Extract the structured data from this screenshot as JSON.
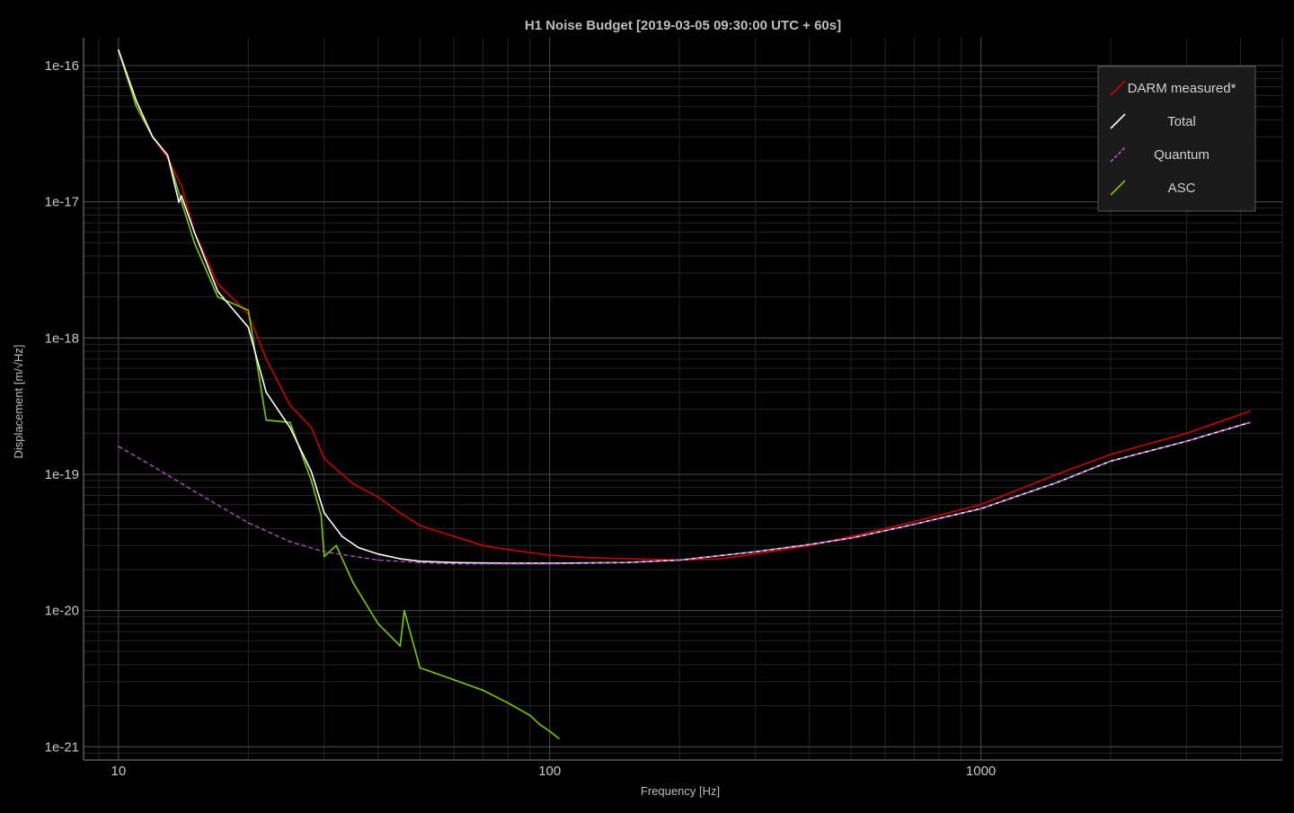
{
  "chart_data": {
    "type": "line",
    "title": "H1 Noise Budget [2019-03-05 09:30:00 UTC + 60s]",
    "xlabel": "Frequency [Hz]",
    "ylabel": "Displacement [m/√Hz]",
    "xscale": "log",
    "yscale": "log",
    "xlim": [
      8.3,
      5000
    ],
    "ylim": [
      8e-22,
      1.6e-16
    ],
    "grid": true,
    "legend_position": "top-right",
    "x_tick_labels": [
      "10",
      "100",
      "1000"
    ],
    "x_tick_values": [
      10,
      100,
      1000
    ],
    "y_tick_labels": [
      "1e-21",
      "1e-20",
      "1e-19",
      "1e-18",
      "1e-17",
      "1e-16"
    ],
    "y_tick_values": [
      1e-21,
      1e-20,
      1e-19,
      1e-18,
      1e-17,
      1e-16
    ],
    "series": [
      {
        "name": "DARM measured*",
        "color": "#cc0000",
        "x": [
          10,
          11,
          12,
          13,
          14,
          15,
          17,
          20,
          22,
          25,
          28,
          30,
          35,
          40,
          45,
          50,
          60,
          70,
          80,
          100,
          120,
          150,
          200,
          250,
          300,
          400,
          500,
          700,
          1000,
          1500,
          2000,
          3000,
          4200
        ],
        "y": [
          1.3e-16,
          5.5e-17,
          3e-17,
          2.1e-17,
          1.3e-17,
          6e-18,
          2.5e-18,
          1.5e-18,
          7e-19,
          3.2e-19,
          2.2e-19,
          1.3e-19,
          8.5e-20,
          6.8e-20,
          5.2e-20,
          4.2e-20,
          3.5e-20,
          3e-20,
          2.8e-20,
          2.55e-20,
          2.45e-20,
          2.4e-20,
          2.35e-20,
          2.4e-20,
          2.6e-20,
          3e-20,
          3.5e-20,
          4.5e-20,
          6e-20,
          1e-19,
          1.4e-19,
          2e-19,
          2.9e-19
        ]
      },
      {
        "name": "Total",
        "color": "#ffffff",
        "x": [
          10,
          11,
          12,
          13,
          13.8,
          14,
          15,
          17,
          20,
          22,
          25,
          28,
          30,
          33,
          36,
          40,
          45,
          50,
          60,
          80,
          100,
          150,
          200,
          300,
          400,
          500,
          700,
          1000,
          1500,
          2000,
          3000,
          4200
        ],
        "y": [
          1.3e-16,
          5.5e-17,
          3e-17,
          2.2e-17,
          1e-17,
          1.1e-17,
          6e-18,
          2.2e-18,
          1.2e-18,
          4e-19,
          2.2e-19,
          1.05e-19,
          5.2e-20,
          3.5e-20,
          2.9e-20,
          2.6e-20,
          2.4e-20,
          2.3e-20,
          2.25e-20,
          2.22e-20,
          2.22e-20,
          2.25e-20,
          2.35e-20,
          2.7e-20,
          3.05e-20,
          3.4e-20,
          4.3e-20,
          5.6e-20,
          8.7e-20,
          1.25e-19,
          1.75e-19,
          2.4e-19
        ]
      },
      {
        "name": "Quantum",
        "color": "#b455c8",
        "x": [
          10,
          12,
          15,
          20,
          25,
          30,
          40,
          50,
          60,
          80,
          100,
          150,
          200,
          300,
          400,
          500,
          700,
          1000,
          1500,
          2000,
          3000,
          4200
        ],
        "y": [
          1.6e-19,
          1.15e-19,
          7.5e-20,
          4.4e-20,
          3.2e-20,
          2.7e-20,
          2.35e-20,
          2.25e-20,
          2.2e-20,
          2.2e-20,
          2.2e-20,
          2.25e-20,
          2.35e-20,
          2.7e-20,
          3.05e-20,
          3.4e-20,
          4.3e-20,
          5.6e-20,
          8.7e-20,
          1.25e-19,
          1.75e-19,
          2.4e-19
        ]
      },
      {
        "name": "ASC",
        "color": "#77cc00",
        "x": [
          10,
          11,
          12,
          13,
          14,
          15,
          17,
          20,
          22,
          25,
          28,
          29.5,
          30,
          32,
          35,
          40,
          45,
          46,
          50,
          60,
          70,
          80,
          90,
          95,
          100,
          105
        ],
        "y": [
          1.3e-16,
          5e-17,
          3e-17,
          2.2e-17,
          1e-17,
          5e-18,
          2e-18,
          1.6e-18,
          2.5e-19,
          2.4e-19,
          9e-20,
          5e-20,
          2.5e-20,
          3e-20,
          1.6e-20,
          8e-21,
          5.5e-21,
          1e-20,
          3.8e-21,
          3.1e-21,
          2.6e-21,
          2.1e-21,
          1.7e-21,
          1.45e-21,
          1.3e-21,
          1.15e-21
        ]
      }
    ]
  }
}
